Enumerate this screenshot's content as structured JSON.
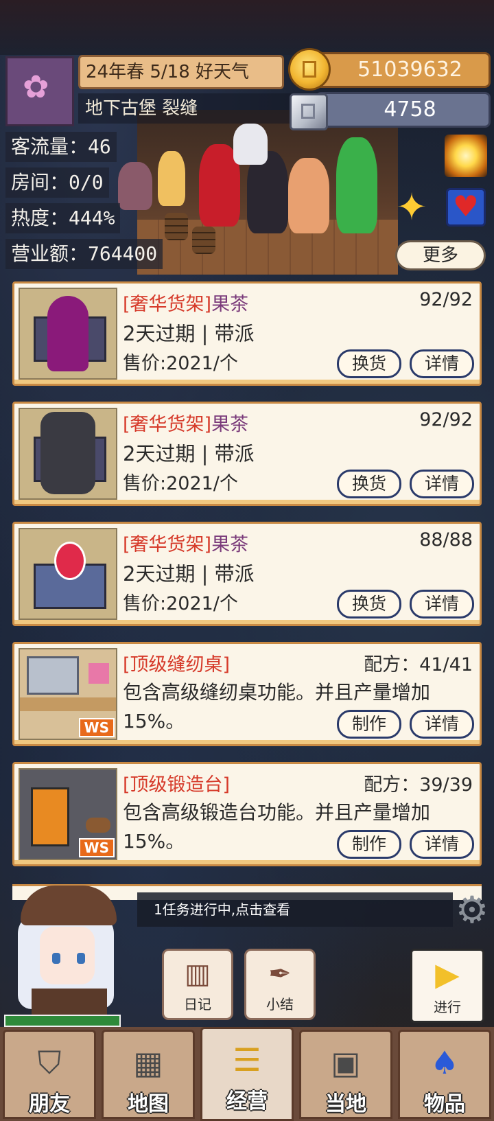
{
  "header": {
    "date_weather": "24年春 5/18 好天气",
    "location": "地下古堡 裂缝",
    "gold": "51039632",
    "gems": "4758",
    "more_label": "更多"
  },
  "stats": [
    {
      "label": "客流量：46"
    },
    {
      "label": "房间：0/0"
    },
    {
      "label": "热度：444%"
    },
    {
      "label": "营业额：764400"
    }
  ],
  "items": [
    {
      "tag": "[奢华货架]",
      "name": "果茶",
      "count": "92/92",
      "line2": "2天过期 | 带派",
      "line3": "售价:2021/个",
      "btn1": "换货",
      "btn2": "详情"
    },
    {
      "tag": "[奢华货架]",
      "name": "果茶",
      "count": "92/92",
      "line2": "2天过期 | 带派",
      "line3": "售价:2021/个",
      "btn1": "换货",
      "btn2": "详情"
    },
    {
      "tag": "[奢华货架]",
      "name": "果茶",
      "count": "88/88",
      "line2": "2天过期 | 带派",
      "line3": "售价:2021/个",
      "btn1": "换货",
      "btn2": "详情"
    },
    {
      "tag": "[顶级缝纫桌]",
      "count": "配方：41/41",
      "desc": "包含高级缝纫桌功能。并且产量增加15%。",
      "badge": "WS",
      "btn1": "制作",
      "btn2": "详情"
    },
    {
      "tag": "[顶级锻造台]",
      "count": "配方：39/39",
      "desc": "包含高级锻造台功能。并且产量增加15%。",
      "badge": "WS",
      "btn1": "制作",
      "btn2": "详情"
    }
  ],
  "task": {
    "text": "1任务进行中,点击查看"
  },
  "quick": {
    "diary": "日记",
    "summary": "小结",
    "proceed": "进行"
  },
  "nav": [
    "朋友",
    "地图",
    "经营",
    "当地",
    "物品"
  ],
  "colors": {
    "accent_tag": "#d63a2a",
    "item_name": "#7a3a7a",
    "gold_bar": "#d99a4a",
    "card_border": "#c98a44"
  }
}
